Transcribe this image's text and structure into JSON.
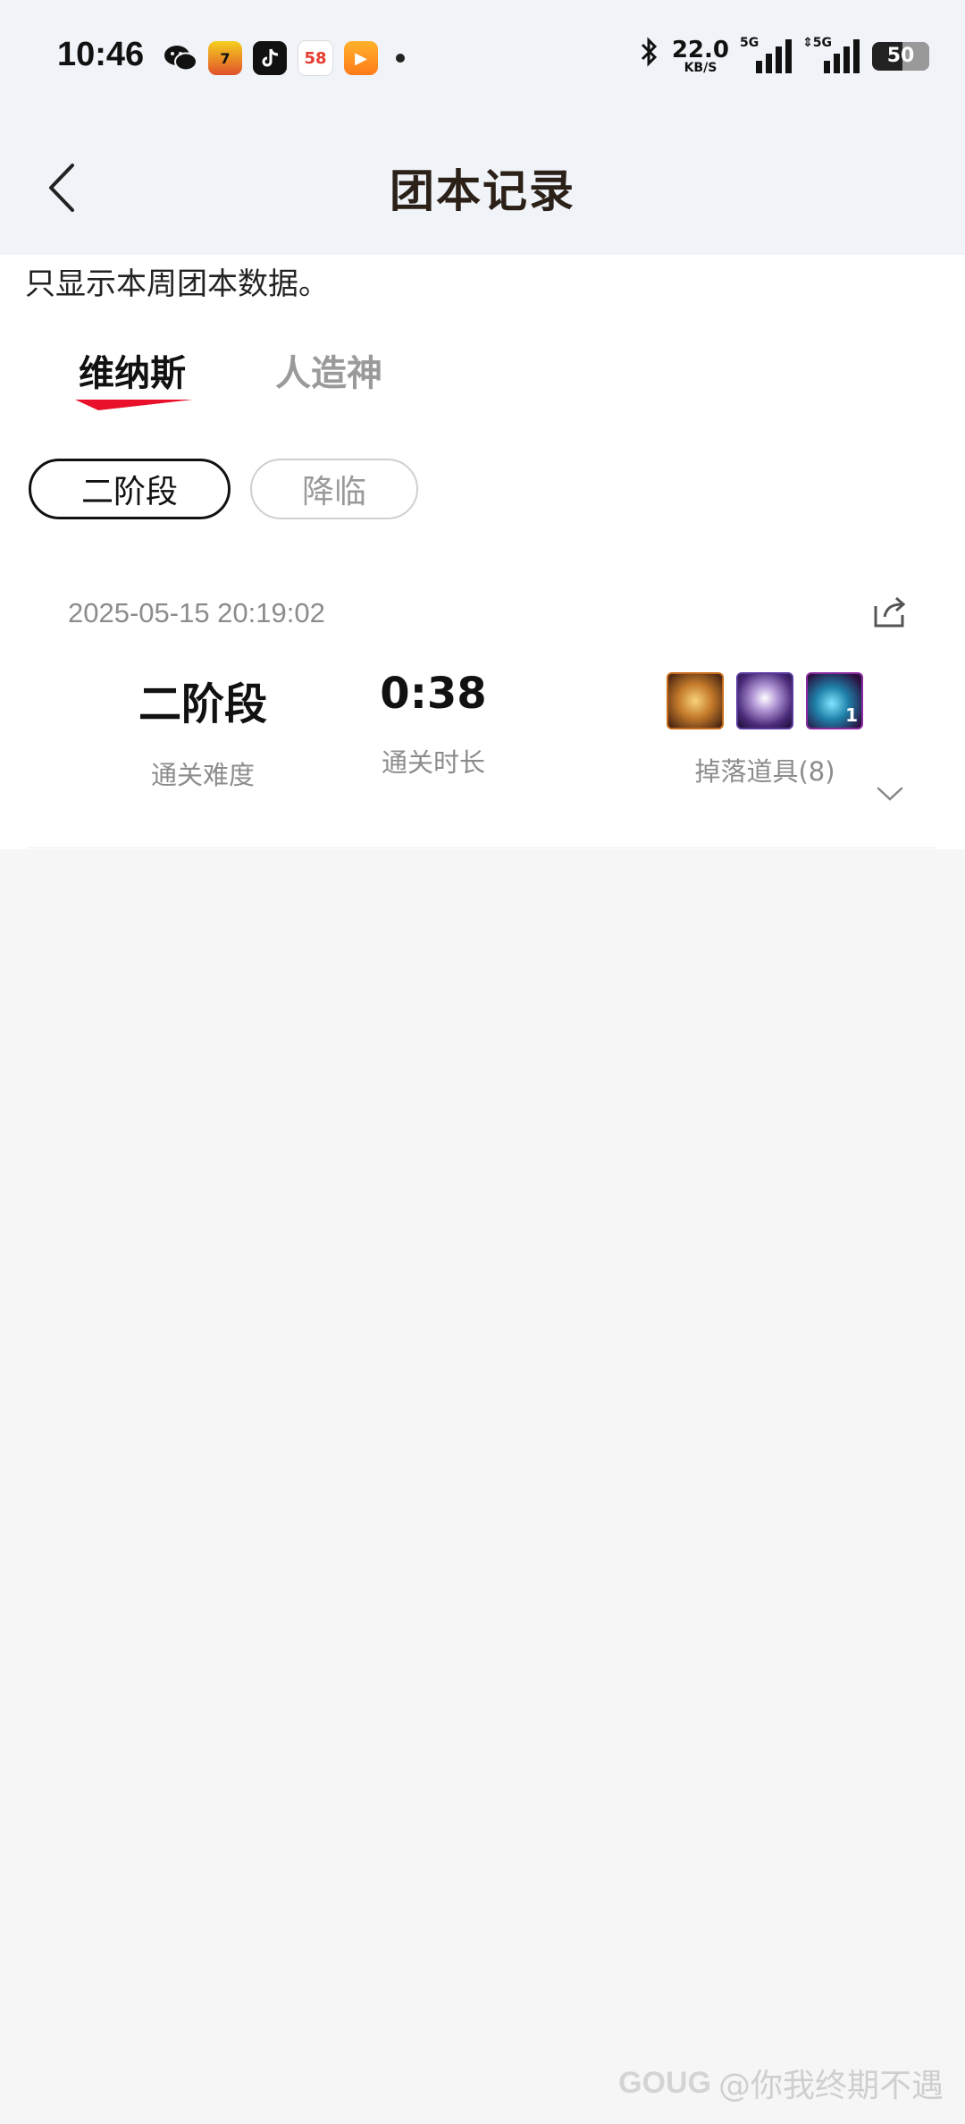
{
  "status_bar": {
    "time": "10:46",
    "net_speed": "22.0",
    "net_unit": "KB/S",
    "signal1_label": "5G",
    "signal2_label": "5G",
    "battery": "50",
    "icons": [
      "wechat-icon",
      "game-app-icon",
      "tiktok-icon",
      "58-app-icon",
      "video-app-icon"
    ]
  },
  "header": {
    "title": "团本记录"
  },
  "notice": "只显示本周团本数据。",
  "tabs": [
    {
      "label": "维纳斯",
      "active": true
    },
    {
      "label": "人造神",
      "active": false
    }
  ],
  "chips": [
    {
      "label": "二阶段",
      "active": true
    },
    {
      "label": "降临",
      "active": false
    }
  ],
  "record": {
    "datetime": "2025-05-15 20:19:02",
    "difficulty_value": "二阶段",
    "difficulty_label": "通关难度",
    "duration_value": "0:38",
    "duration_label": "通关时长",
    "drops_label": "掉落道具(8)",
    "drop_items": [
      {
        "icon": "golden-wings-item-icon",
        "qty": ""
      },
      {
        "icon": "purple-box-item-icon",
        "qty": ""
      },
      {
        "icon": "blue-crystal-item-icon",
        "qty": "1"
      }
    ]
  },
  "watermark": {
    "logo": "GOUG",
    "text": "@你我终期不遇"
  },
  "colors": {
    "accent": "#e8102a",
    "topbar_bg": "#f0f3f8",
    "page_bg": "#f6f6f6"
  }
}
